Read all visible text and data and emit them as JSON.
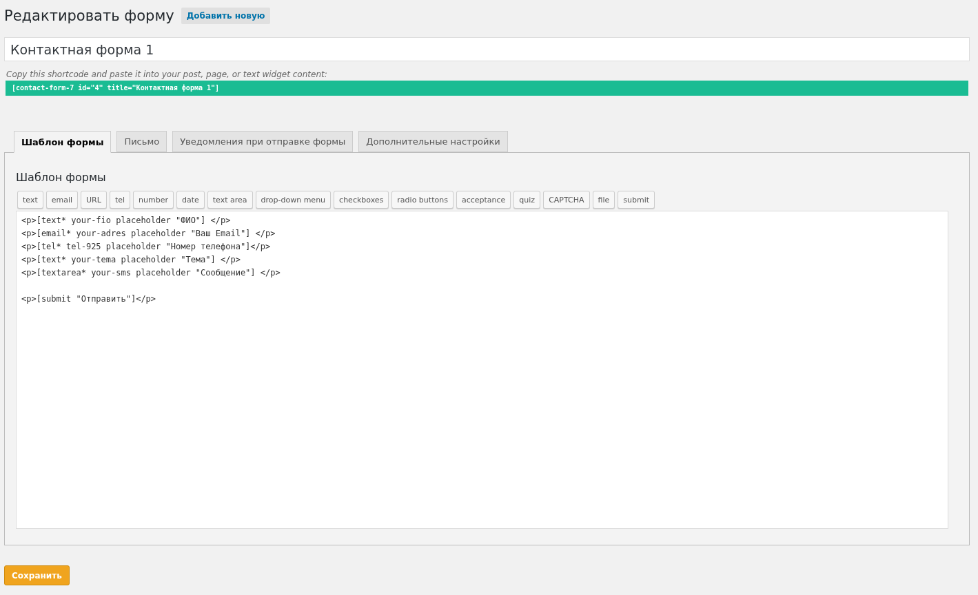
{
  "header": {
    "title": "Редактировать форму",
    "add_new": "Добавить новую"
  },
  "form_title": {
    "value": "Контактная форма 1"
  },
  "shortcode": {
    "hint": "Copy this shortcode and paste it into your post, page, or text widget content:",
    "code": "[contact-form-7 id=\"4\" title=\"Контактная форма 1\"]"
  },
  "tabs": [
    {
      "label": "Шаблон формы",
      "selected": true
    },
    {
      "label": "Письмо",
      "selected": false
    },
    {
      "label": "Уведомления при отправке формы",
      "selected": false
    },
    {
      "label": "Дополнительные настройки",
      "selected": false
    }
  ],
  "panel": {
    "heading": "Шаблон формы",
    "tag_buttons": [
      "text",
      "email",
      "URL",
      "tel",
      "number",
      "date",
      "text area",
      "drop-down menu",
      "checkboxes",
      "radio buttons",
      "acceptance",
      "quiz",
      "CAPTCHA",
      "file",
      "submit"
    ],
    "editor": {
      "value": "<p>[text* your-fio placeholder \"ФИО\"] </p>\n<p>[email* your-adres placeholder \"Ваш Email\"] </p>\n<p>[tel* tel-925 placeholder \"Номер телефона\"]</p>\n<p>[text* your-tema placeholder \"Тема\"] </p>\n<p>[textarea* your-sms placeholder \"Сообщение\"] </p>\n\n<p>[submit \"Отправить\"]</p>"
    }
  },
  "save_button": "Сохранить"
}
